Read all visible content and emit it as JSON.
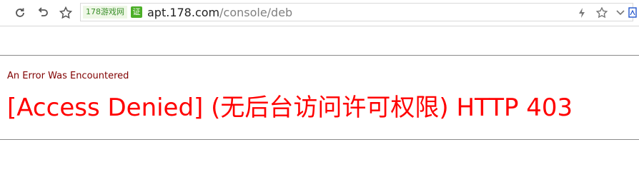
{
  "browser": {
    "site_tag": "178游戏网",
    "cert_badge": "证",
    "url_host": "apt.178.com",
    "url_path": "/console/deb",
    "icons": [
      "refresh-icon",
      "back-icon",
      "star-icon",
      "lightning-icon",
      "star-icon",
      "chevron-down-icon",
      "search-icon"
    ]
  },
  "page": {
    "error_subtitle": "An Error Was Encountered",
    "error_message": "[Access Denied] (无后台访问许可权限) HTTP 403"
  },
  "colors": {
    "subtitle": "#800000",
    "message": "#ff0000",
    "rule": "#8a8a8a"
  }
}
